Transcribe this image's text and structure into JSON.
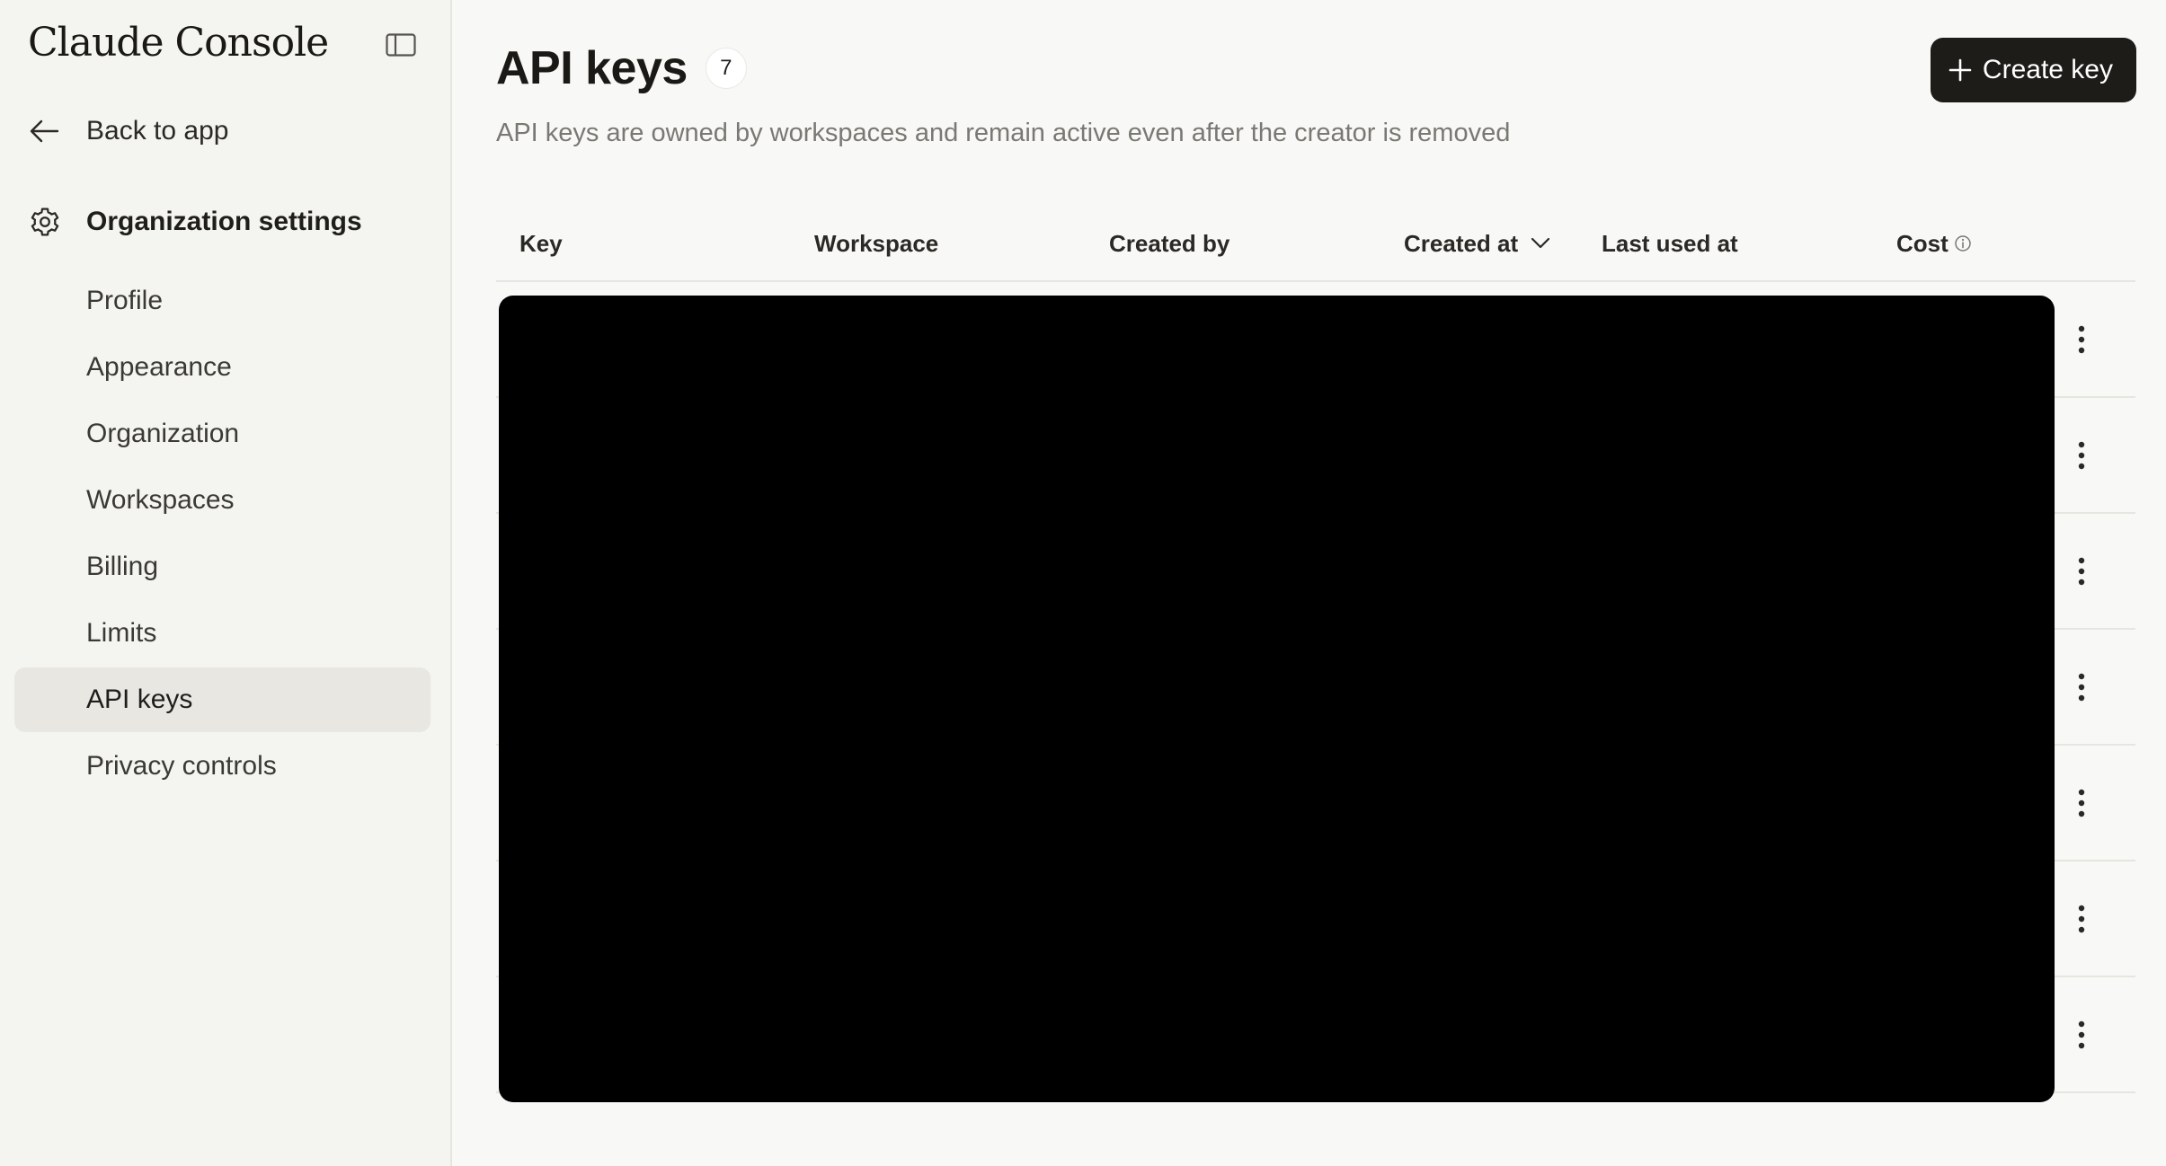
{
  "sidebar": {
    "brand": "Claude Console",
    "back_label": "Back to app",
    "section_title": "Organization settings",
    "items": [
      {
        "label": "Profile",
        "active": false
      },
      {
        "label": "Appearance",
        "active": false
      },
      {
        "label": "Organization",
        "active": false
      },
      {
        "label": "Workspaces",
        "active": false
      },
      {
        "label": "Billing",
        "active": false
      },
      {
        "label": "Limits",
        "active": false
      },
      {
        "label": "API keys",
        "active": true
      },
      {
        "label": "Privacy controls",
        "active": false
      }
    ]
  },
  "header": {
    "title": "API keys",
    "count": "7",
    "subtitle": "API keys are owned by workspaces and remain active even after the creator is removed",
    "create_label": "Create key"
  },
  "table": {
    "columns": [
      "Key",
      "Workspace",
      "Created by",
      "Created at",
      "Last used at",
      "Cost"
    ],
    "row_count": 7
  },
  "icons": {
    "collapse": "sidebar-toggle-icon",
    "back": "arrow-left-icon",
    "settings": "gear-icon",
    "sort": "chevron-down-icon",
    "info": "info-icon",
    "menu": "more-vertical-icon",
    "plus": "plus-icon"
  },
  "colors": {
    "primary_button": "#1d1c19",
    "active_nav": "#e8e7e2",
    "background": "#f8f8f6"
  }
}
